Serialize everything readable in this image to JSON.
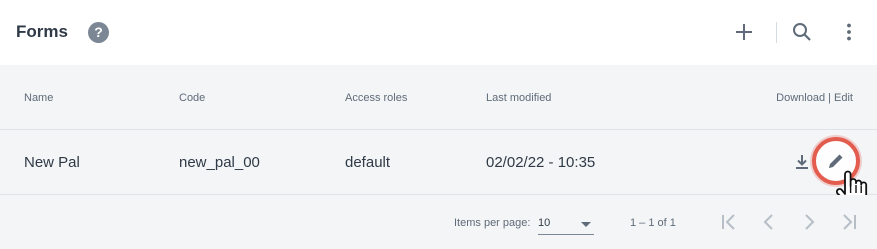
{
  "header": {
    "title": "Forms",
    "help_icon": "help-icon",
    "actions": [
      "add-icon",
      "search-icon",
      "more-vert-icon"
    ]
  },
  "table": {
    "columns": {
      "name": "Name",
      "code": "Code",
      "access_roles": "Access roles",
      "last_modified": "Last modified",
      "actions": "Download | Edit"
    },
    "rows": [
      {
        "name": "New Pal",
        "code": "new_pal_00",
        "access_roles": "default",
        "last_modified": "02/02/22 - 10:35",
        "icons": [
          "download-icon",
          "edit-icon"
        ]
      }
    ]
  },
  "paginator": {
    "items_per_page_label": "Items per page:",
    "items_per_page_value": "10",
    "range_label": "1 – 1 of 1",
    "buttons": [
      "first-page-icon",
      "previous-page-icon",
      "next-page-icon",
      "last-page-icon"
    ]
  },
  "colors": {
    "highlight": "#e35d4f",
    "surface": "#f3f5f7",
    "text": "#2f3a46"
  }
}
